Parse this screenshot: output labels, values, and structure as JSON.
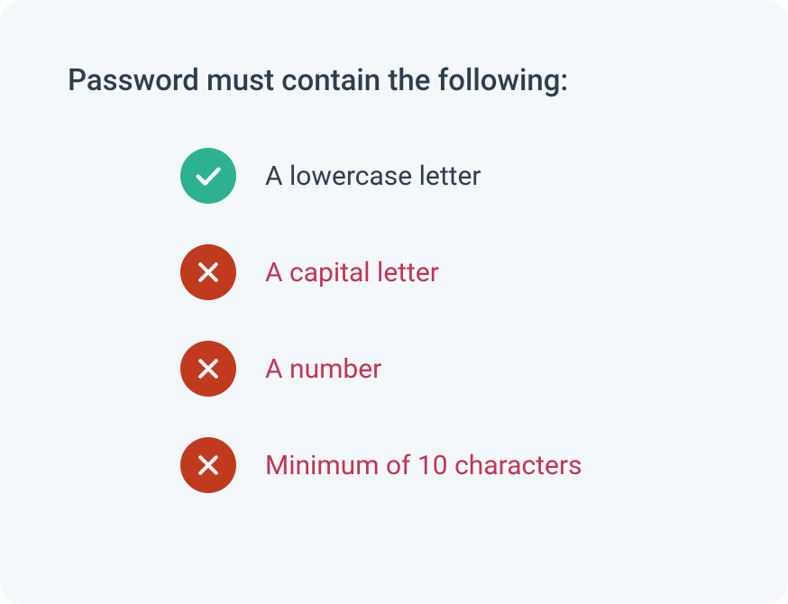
{
  "title": "Password must contain the following:",
  "requirements": [
    {
      "label": "A lowercase letter",
      "valid": true
    },
    {
      "label": "A capital letter",
      "valid": false
    },
    {
      "label": "A number",
      "valid": false
    },
    {
      "label": "Minimum of 10 characters",
      "valid": false
    }
  ]
}
